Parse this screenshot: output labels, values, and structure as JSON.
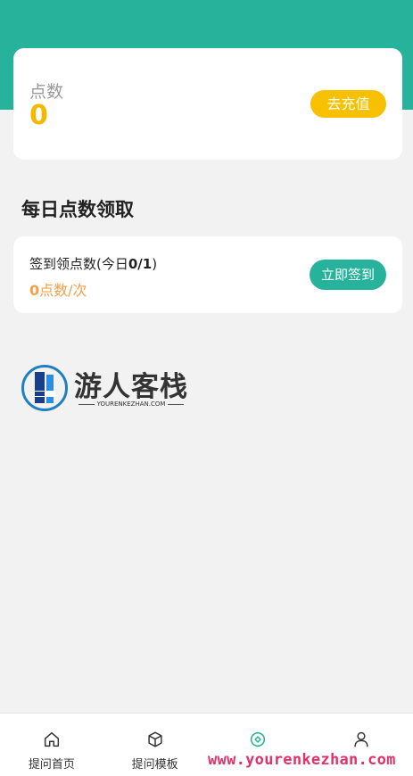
{
  "points_card": {
    "label": "点数",
    "value": "0",
    "recharge_button": "去充值"
  },
  "daily": {
    "section_title": "每日点数领取",
    "signin_title_prefix": "签到领点数(今日",
    "signin_progress": "0/1",
    "signin_title_suffix": ")",
    "reward_amount": "0",
    "reward_unit": "点数/次",
    "signin_button": "立即签到"
  },
  "brand": {
    "name": "游人客栈",
    "domain": "YOURENKEZHAN.COM"
  },
  "tabbar": {
    "items": [
      {
        "label": "提问首页",
        "icon": "home-icon"
      },
      {
        "label": "提问模板",
        "icon": "cube-icon"
      },
      {
        "label": "",
        "icon": "target-icon",
        "active": true
      },
      {
        "label": "",
        "icon": "user-icon"
      }
    ]
  },
  "watermark": "www.yourenkezhan.com",
  "colors": {
    "primary": "#27b39b",
    "accent_yellow": "#f7c000",
    "reward_orange": "#f2a14a",
    "watermark": "#e0326a"
  }
}
